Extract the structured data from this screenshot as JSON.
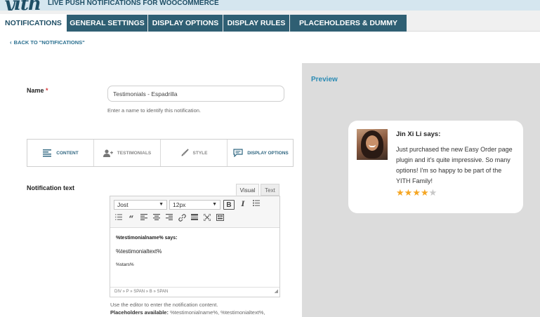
{
  "header": {
    "logo": "yith",
    "title": "LIVE PUSH NOTIFICATIONS FOR WOOCOMMERCE"
  },
  "tabs": [
    {
      "label": "NOTIFICATIONS",
      "active": true
    },
    {
      "label": "GENERAL SETTINGS",
      "active": false
    },
    {
      "label": "DISPLAY OPTIONS",
      "active": false
    },
    {
      "label": "DISPLAY RULES",
      "active": false
    },
    {
      "label": "PLACEHOLDERS & DUMMY INFO",
      "active": false
    }
  ],
  "back_link": "BACK TO \"NOTIFICATIONS\"",
  "form": {
    "name_label": "Name",
    "required_mark": "*",
    "name_value": "Testimonials - Espadrilla",
    "name_hint": "Enter a name to identify this notification.",
    "subtabs": [
      {
        "label": "CONTENT",
        "icon": "align-left-icon",
        "active": true
      },
      {
        "label": "TESTIMONIALS",
        "icon": "user-add-icon",
        "active": false
      },
      {
        "label": "STYLE",
        "icon": "paintbrush-icon",
        "active": false
      },
      {
        "label": "DISPLAY OPTIONS",
        "icon": "chat-bubble-icon",
        "active": false
      }
    ],
    "notification_text_label": "Notification text"
  },
  "editor": {
    "tab_visual": "Visual",
    "tab_text": "Text",
    "font_family": "Jost",
    "font_size": "12px",
    "toolbar_icons": [
      "bold-icon",
      "italic-icon",
      "bullet-list-icon",
      "numbered-list-icon",
      "blockquote-icon",
      "align-left-icon",
      "align-center-icon",
      "align-right-icon",
      "link-icon",
      "read-more-icon",
      "fullscreen-icon",
      "toolbar-toggle-icon"
    ],
    "bold_label": "B",
    "italic_label": "I",
    "content": {
      "line1": "%testimonialname% says:",
      "line2": "%testimonialtext%",
      "line3": "%stars%"
    },
    "status_path": "DIV » P » SPAN » B » SPAN",
    "help_text": "Use the editor to enter the notification content.",
    "placeholders_label": "Placeholders available:",
    "placeholders_value": "%testimonialname%, %testimonialtext%,"
  },
  "preview": {
    "title": "Preview",
    "notification": {
      "name": "Jin Xi Li says:",
      "text": "Just purchased the new Easy Order page plugin and it's quite impressive. So many options! I'm so happy to be part of the YITH Family!",
      "stars": 4,
      "max_stars": 5
    }
  },
  "colors": {
    "tab_bg": "#2f5f73",
    "accent": "#2a8ab3",
    "star": "#f5a623"
  }
}
